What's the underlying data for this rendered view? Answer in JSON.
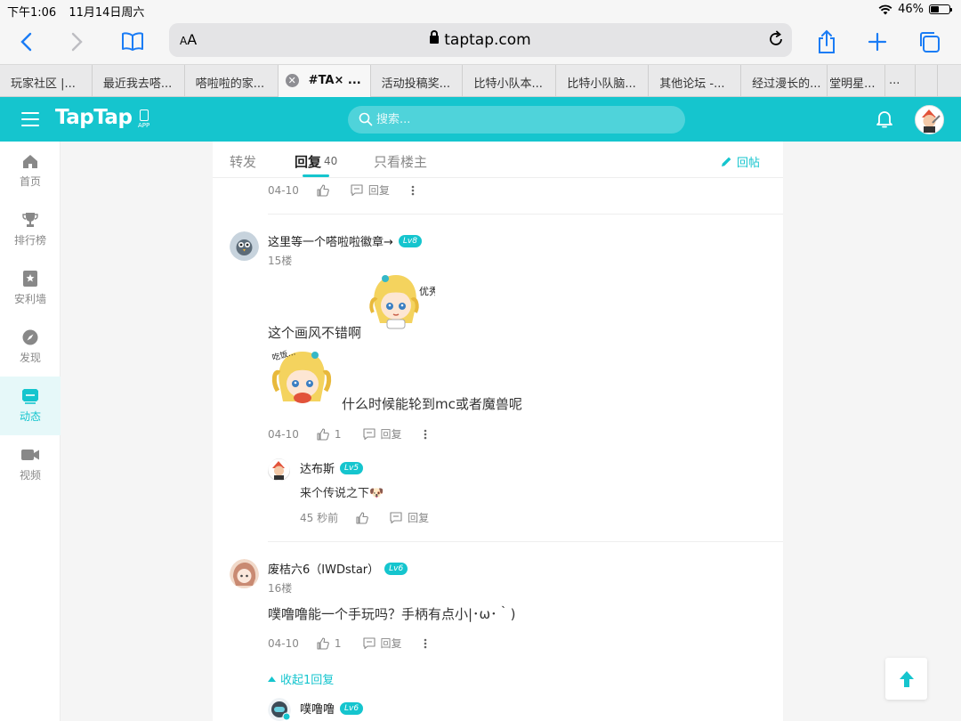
{
  "status_bar": {
    "time": "下午1:06",
    "date": "11月14日周六",
    "battery": "46%",
    "battery_level": 0.46
  },
  "browser": {
    "aa_label": "AA",
    "url": "taptap.com",
    "tabs": [
      {
        "label": "玩家社区 |..."
      },
      {
        "label": "最近我去嗒..."
      },
      {
        "label": "嗒啦啦的家..."
      },
      {
        "label": "#TA× ..."
      },
      {
        "label": "活动投稿奖..."
      },
      {
        "label": "比特小队本..."
      },
      {
        "label": "比特小队脑..."
      },
      {
        "label": "其他论坛 -..."
      },
      {
        "label": "经过漫长的..."
      },
      {
        "label": "堂明星..."
      },
      {
        "label": "..."
      }
    ]
  },
  "site": {
    "logo": "TapTap",
    "app_label": "APP",
    "search_placeholder": "搜索..."
  },
  "nav": {
    "items": [
      {
        "label": "首页",
        "icon": "home-icon"
      },
      {
        "label": "排行榜",
        "icon": "trophy-icon"
      },
      {
        "label": "安利墙",
        "icon": "star-bookmark-icon"
      },
      {
        "label": "发现",
        "icon": "compass-icon"
      },
      {
        "label": "动态",
        "icon": "feed-icon"
      },
      {
        "label": "视频",
        "icon": "video-icon"
      }
    ]
  },
  "thread": {
    "tab_repost": "转发",
    "tab_reply": "回复",
    "reply_count": "40",
    "tab_owner_only": "只看楼主",
    "reply_post": "回帖",
    "prev": {
      "date": "04-10",
      "reply_label": "回复"
    },
    "posts": [
      {
        "username": "这里等一个嗒啦啦徽章→",
        "level": "Lv8",
        "floor": "15楼",
        "line1": "这个画风不错啊",
        "sticker1_text": "优秀",
        "sticker2_text": "吃饭...",
        "line2": "什么时候能轮到mc或者魔兽呢",
        "date": "04-10",
        "likes": "1",
        "reply_label": "回复",
        "sub_reply": {
          "username": "达布斯",
          "level": "Lv5",
          "text": "来个传说之下🐶",
          "time": "45 秒前",
          "reply_label": "回复"
        }
      },
      {
        "username": "废桔六6（IWDstar）",
        "level": "Lv6",
        "floor": "16楼",
        "text": "噗噜噜能一个手玩吗？手柄有点小|･ω･｀)",
        "date": "04-10",
        "likes": "1",
        "reply_label": "回复",
        "collapse_label": "收起1回复",
        "sub_reply": {
          "username": "噗噜噜",
          "level": "Lv6"
        }
      }
    ]
  },
  "colors": {
    "brand": "#15c5ce",
    "browser_blue": "#1a7cf5"
  }
}
